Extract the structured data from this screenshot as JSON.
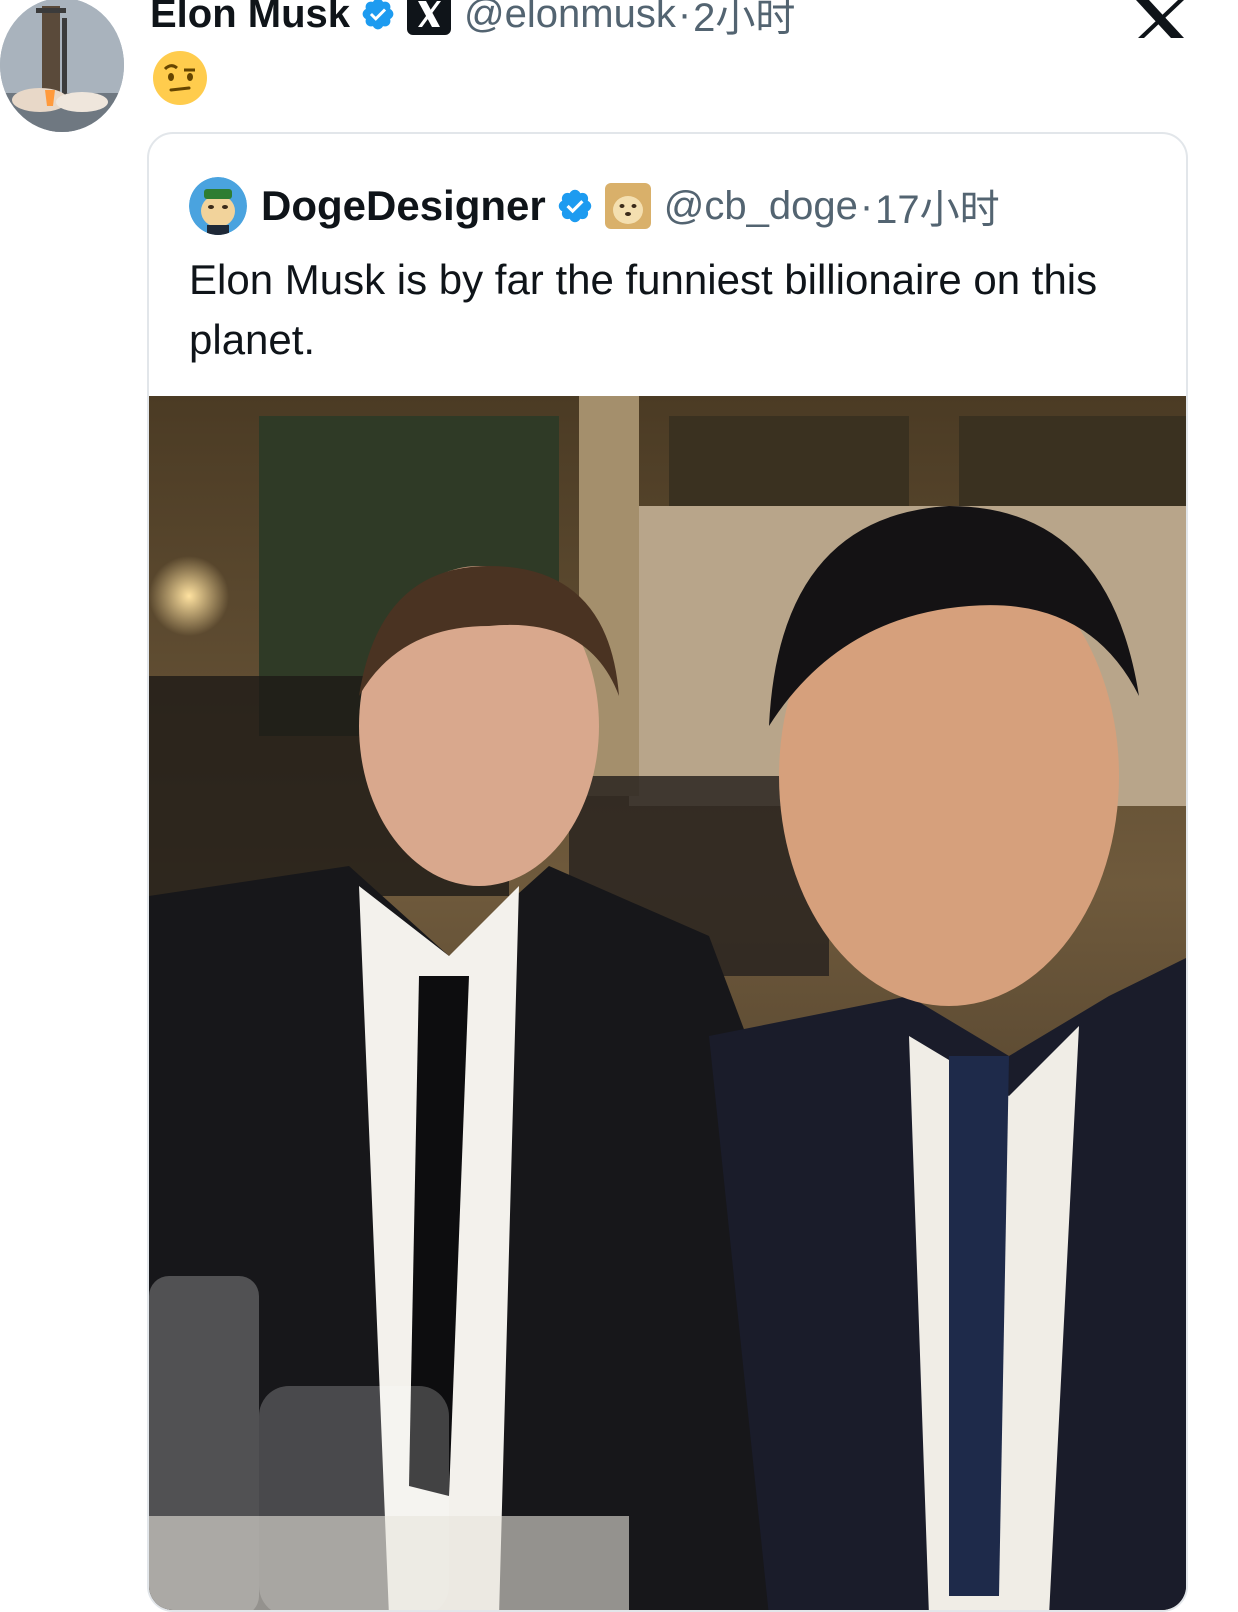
{
  "tweet": {
    "author_name": "Elon Musk",
    "handle": "@elonmusk",
    "separator": "·",
    "time": "2小时",
    "avatar_icon": "rocket-launch-avatar",
    "reply_icon": "raised-eyebrow-emoji"
  },
  "quote": {
    "author_name": "DogeDesigner",
    "handle": "@cb_doge",
    "separator": "·",
    "time": "17小时",
    "text": "Elon Musk is by far the funniest billionaire on this planet.",
    "avatar_icon": "doge-avatar",
    "photo_icon": "selfie-photo"
  },
  "colors": {
    "verified_blue": "#1d9bf0",
    "secondary_text": "#536471",
    "border": "#e2e6ea"
  }
}
